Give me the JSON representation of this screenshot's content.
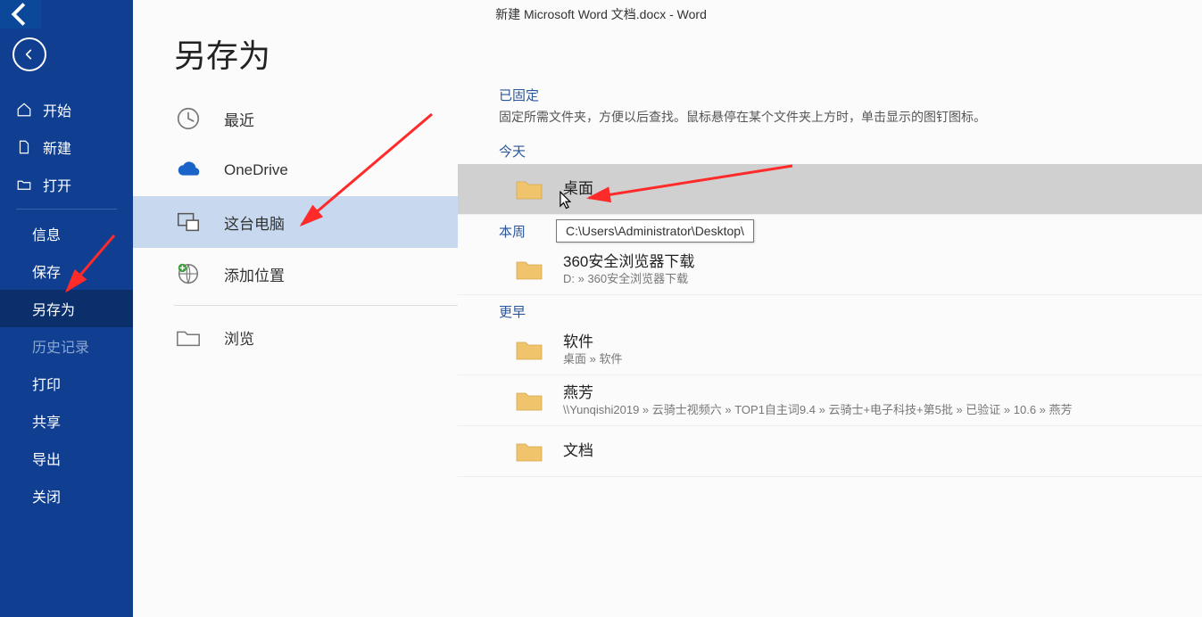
{
  "title": "新建 Microsoft Word 文档.docx  -  Word",
  "page_title": "另存为",
  "sidebar": [
    {
      "key": "start",
      "label": "开始",
      "icon": "home"
    },
    {
      "key": "new",
      "label": "新建",
      "icon": "new"
    },
    {
      "key": "open",
      "label": "打开",
      "icon": "open"
    },
    {
      "sep": true
    },
    {
      "key": "info",
      "label": "信息",
      "sub": true
    },
    {
      "key": "save",
      "label": "保存",
      "sub": true
    },
    {
      "key": "saveas",
      "label": "另存为",
      "sub": true,
      "selected": true
    },
    {
      "key": "history",
      "label": "历史记录",
      "sub": true,
      "disabled": true
    },
    {
      "key": "print",
      "label": "打印",
      "sub": true
    },
    {
      "key": "share",
      "label": "共享",
      "sub": true
    },
    {
      "key": "export",
      "label": "导出",
      "sub": true
    },
    {
      "key": "close",
      "label": "关闭",
      "sub": true
    }
  ],
  "options": [
    {
      "key": "recent",
      "label": "最近",
      "icon": "clock"
    },
    {
      "key": "onedrive",
      "label": "OneDrive",
      "icon": "cloud"
    },
    {
      "key": "thispc",
      "label": "这台电脑",
      "icon": "pc",
      "selected": true
    },
    {
      "key": "addplace",
      "label": "添加位置",
      "icon": "globeplus"
    },
    {
      "key": "sep",
      "sep": true
    },
    {
      "key": "browse",
      "label": "浏览",
      "icon": "folder"
    }
  ],
  "pinned": {
    "title": "已固定",
    "desc": "固定所需文件夹，方便以后查找。鼠标悬停在某个文件夹上方时，单击显示的图钉图标。"
  },
  "groups": [
    {
      "label": "今天",
      "items": [
        {
          "name": "桌面",
          "hover": true
        }
      ]
    },
    {
      "label": "本周",
      "items": [
        {
          "name": "360安全浏览器下载",
          "path": "D: » 360安全浏览器下载"
        }
      ]
    },
    {
      "label": "更早",
      "items": [
        {
          "name": "软件",
          "path": "桌面 » 软件"
        },
        {
          "name": "燕芳",
          "path": "\\\\Yunqishi2019 » 云骑士视频六 » TOP1自主词9.4 » 云骑士+电子科技+第5批 » 已验证 » 10.6 » 燕芳"
        },
        {
          "name": "文档"
        }
      ]
    }
  ],
  "tooltip": "C:\\Users\\Administrator\\Desktop\\"
}
